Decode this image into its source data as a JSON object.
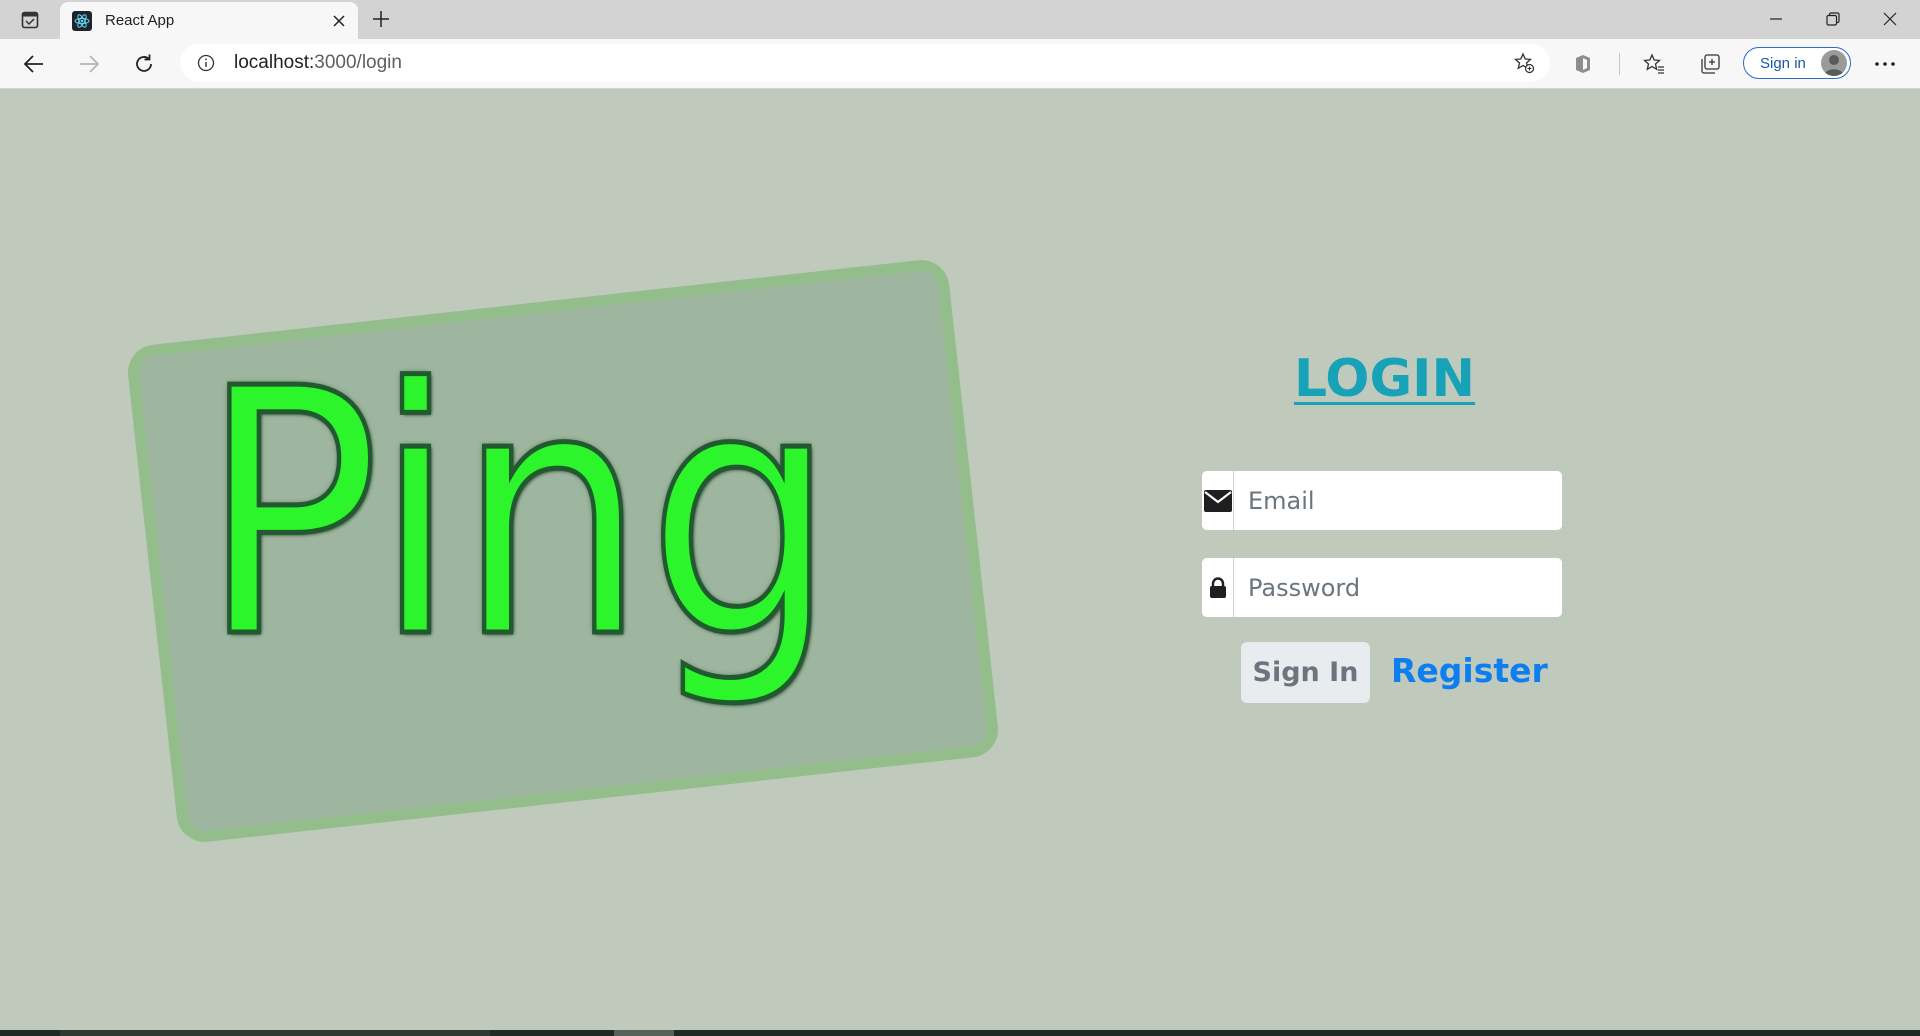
{
  "browser": {
    "tab": {
      "title": "React App"
    },
    "address": {
      "host": "localhost:",
      "path": "3000/login"
    },
    "profile": {
      "sign_in_label": "Sign in"
    }
  },
  "page": {
    "logo_text": "Ping",
    "login_title": "LOGIN",
    "email": {
      "placeholder": "Email",
      "value": ""
    },
    "password": {
      "placeholder": "Password",
      "value": ""
    },
    "sign_in_button": "Sign In",
    "register_link": "Register"
  },
  "colors": {
    "page_background": "#bfc9bc",
    "logo_green": "#2cf52b",
    "login_title": "#17a2b8",
    "register_link": "#0d7ef0"
  },
  "icons": {
    "tab_actions": "tab-actions-icon",
    "favicon": "react-icon",
    "close": "close-icon",
    "new_tab": "plus-icon",
    "back": "back-arrow-icon",
    "forward": "forward-arrow-icon",
    "refresh": "refresh-icon",
    "site_info": "info-icon",
    "add_favorite": "star-plus-icon",
    "extensions": "extension-icon",
    "favorites": "favorites-icon",
    "collections": "collections-icon",
    "more": "more-icon",
    "email": "envelope-icon",
    "password": "lock-icon"
  }
}
